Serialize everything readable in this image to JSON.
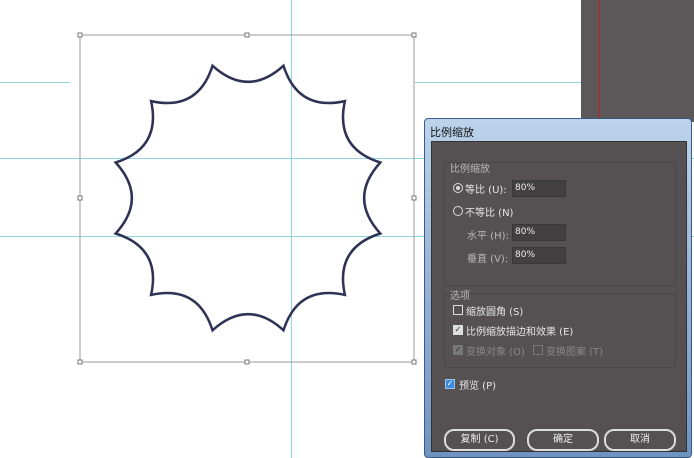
{
  "dialog": {
    "title": "比例缩放",
    "scale_group": {
      "label": "比例缩放",
      "uniform": {
        "label": "等比 (U):",
        "value": "80%",
        "selected": true
      },
      "non_uniform": {
        "label": "不等比 (N)",
        "selected": false
      },
      "horizontal": {
        "label": "水平 (H):",
        "value": "80%"
      },
      "vertical": {
        "label": "垂直 (V):",
        "value": "80%"
      }
    },
    "options": {
      "label": "选项",
      "scale_corners": {
        "label": "缩放圆角 (S)",
        "checked": false
      },
      "scale_strokes": {
        "label": "比例缩放描边和效果 (E)",
        "checked": true
      },
      "transform_objects": {
        "label": "变换对象 (O)",
        "checked": true
      },
      "transform_patterns": {
        "label": "变换图案 (T)",
        "checked": false
      }
    },
    "preview": {
      "label": "预览 (P)",
      "checked": true
    },
    "buttons": {
      "copy": "复制 (C)",
      "ok": "确定",
      "cancel": "取消"
    }
  },
  "colors": {
    "shape_stroke": "#2e3356",
    "guide": "#8fd8e0",
    "dialog_bg": "#555152"
  }
}
